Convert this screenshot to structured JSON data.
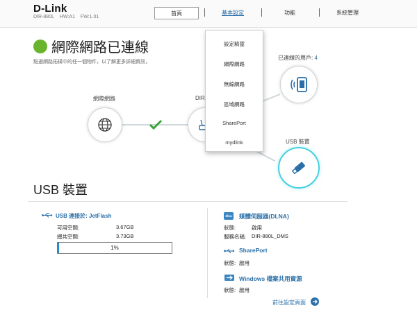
{
  "header": {
    "brand": "D-Link",
    "model": "DIR-880L",
    "hw": "HW:A1",
    "fw": "FW:1.01",
    "nav": {
      "home": "首頁",
      "basic": "基本設定",
      "features": "功能",
      "management": "系統管理"
    }
  },
  "status": {
    "title": "網際網路已連線",
    "subtitle": "點選網路拓樸中的任一個物件，以了解更多詳細資訊，"
  },
  "topology": {
    "internet_label": "網際網路",
    "router_label": "DIR",
    "clients_label": "已連線的用戶:",
    "clients_count": "4",
    "usb_label": "USB 裝置"
  },
  "dropdown": {
    "items": [
      "設定精靈",
      "網際網路",
      "無線網路",
      "區域網路",
      "SharePort",
      "mydlink"
    ]
  },
  "usb": {
    "heading": "USB 裝置",
    "connection": "USB 連接於: JetFlash",
    "available_label": "可用空間:",
    "available_value": "3.67GB",
    "total_label": "總共空間:",
    "total_value": "3.73GB",
    "usage_percent": 1,
    "usage_text": "1%"
  },
  "services": {
    "dlna": {
      "icon_text": "dlna",
      "title": "媒體伺服器(DLNA)",
      "status_label": "狀態:",
      "status_value": "啟用",
      "name_label": "服務名稱:",
      "name_value": "DIR-880L_DMS"
    },
    "shareport": {
      "title": "SharePort",
      "status_label": "狀態:",
      "status_value": "啟用"
    },
    "windows": {
      "title": "Windows 檔案共用資源",
      "status_label": "狀態:",
      "status_value": "啟用"
    }
  },
  "more_link": "前往設定頁面",
  "colors": {
    "accent": "#2a6fa8",
    "connected": "#6ab42d",
    "usb_highlight": "#45d0e0",
    "progress": "#2a88c8"
  }
}
